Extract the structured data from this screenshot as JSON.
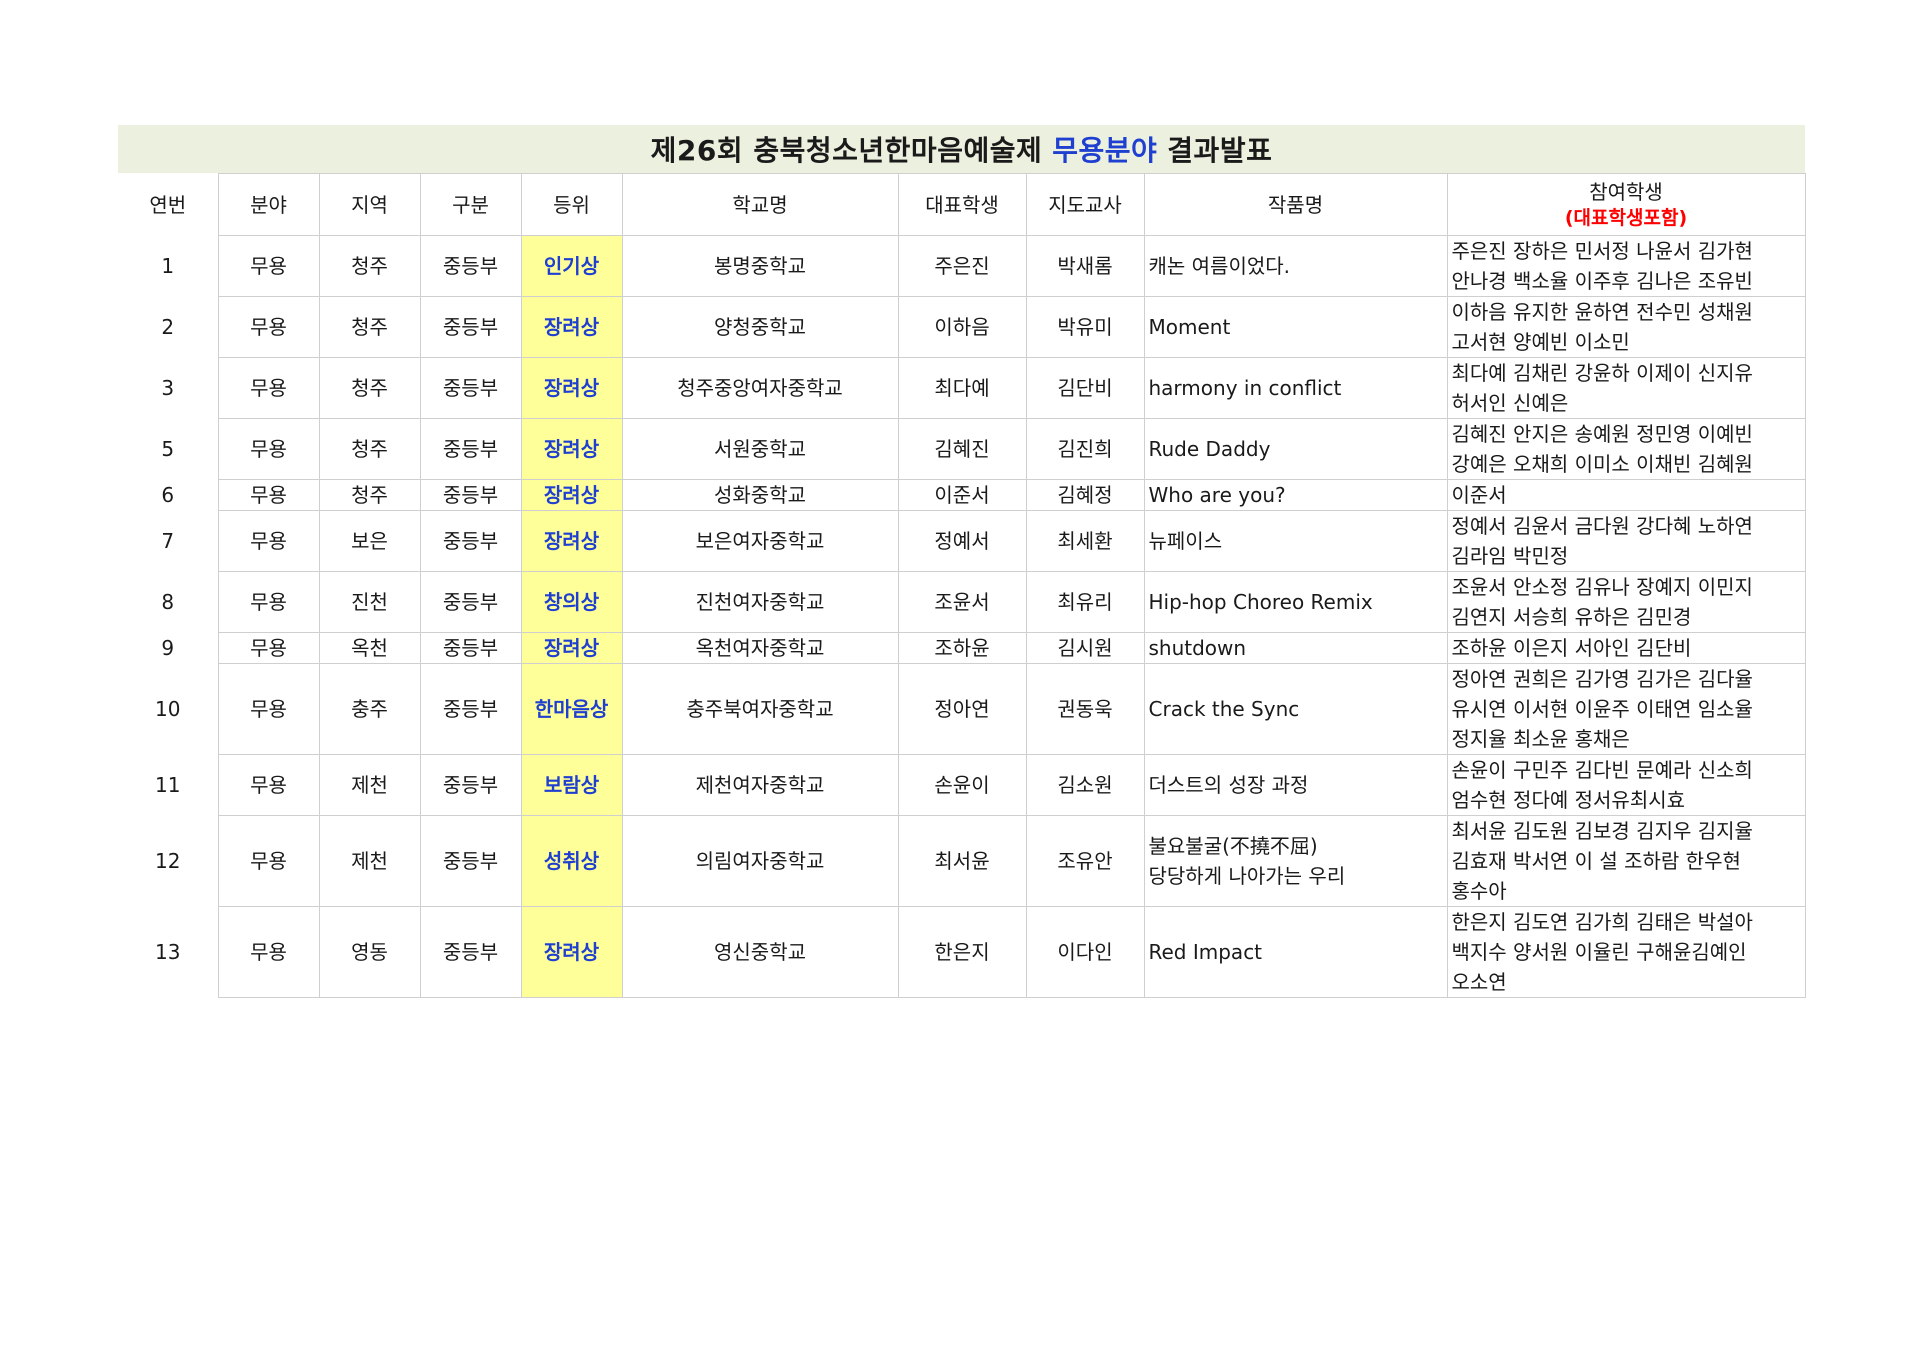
{
  "title": {
    "prefix": "제26회 충북청소년한마음예술제",
    "highlight": "무용분야",
    "suffix": "결과발표"
  },
  "headers": {
    "no": "연번",
    "field": "분야",
    "region": "지역",
    "division": "구분",
    "rank": "등위",
    "school": "학교명",
    "rep": "대표학생",
    "teacher": "지도교사",
    "work": "작품명",
    "students": "참여학생",
    "students_note": "(대표학생포함)"
  },
  "colors": {
    "title_bg": "#ebf1de",
    "award_bg": "#ffff99",
    "award_text": "#1f3fd1",
    "note_text": "#ff0000"
  },
  "rows": [
    {
      "no": "1",
      "field": "무용",
      "region": "청주",
      "division": "중등부",
      "rank": "인기상",
      "school": "봉명중학교",
      "rep": "주은진",
      "teacher": "박새롬",
      "work": [
        "캐논 여름이었다."
      ],
      "students": [
        "주은진 장하은 민서정 나윤서 김가현",
        "안나경 백소율 이주후 김나은 조유빈"
      ]
    },
    {
      "no": "2",
      "field": "무용",
      "region": "청주",
      "division": "중등부",
      "rank": "장려상",
      "school": "양청중학교",
      "rep": "이하음",
      "teacher": "박유미",
      "work": [
        "Moment"
      ],
      "students": [
        "이하음 유지한 윤하연 전수민 성채원",
        "고서현 양예빈 이소민"
      ]
    },
    {
      "no": "3",
      "field": "무용",
      "region": "청주",
      "division": "중등부",
      "rank": "장려상",
      "school": "청주중앙여자중학교",
      "rep": "최다예",
      "teacher": "김단비",
      "work": [
        "harmony in conflict"
      ],
      "students": [
        "최다예 김채린 강윤하 이제이 신지유",
        "허서인 신예은"
      ]
    },
    {
      "no": "5",
      "field": "무용",
      "region": "청주",
      "division": "중등부",
      "rank": "장려상",
      "school": "서원중학교",
      "rep": "김혜진",
      "teacher": "김진희",
      "work": [
        "Rude Daddy"
      ],
      "students": [
        "김혜진 안지은 송예원 정민영 이예빈",
        "강예은 오채희 이미소 이채빈 김혜원"
      ]
    },
    {
      "no": "6",
      "field": "무용",
      "region": "청주",
      "division": "중등부",
      "rank": "장려상",
      "school": "성화중학교",
      "rep": "이준서",
      "teacher": "김혜정",
      "work": [
        "Who are you?"
      ],
      "students": [
        "이준서"
      ]
    },
    {
      "no": "7",
      "field": "무용",
      "region": "보은",
      "division": "중등부",
      "rank": "장려상",
      "school": "보은여자중학교",
      "rep": "정예서",
      "teacher": "최세환",
      "work": [
        "뉴페이스"
      ],
      "students": [
        "정예서 김윤서 금다원 강다혜 노하연",
        "김라임 박민정"
      ]
    },
    {
      "no": "8",
      "field": "무용",
      "region": "진천",
      "division": "중등부",
      "rank": "창의상",
      "school": "진천여자중학교",
      "rep": "조윤서",
      "teacher": "최유리",
      "work": [
        "Hip-hop Choreo Remix"
      ],
      "students": [
        "조윤서 안소정 김유나 장예지 이민지",
        "김연지 서승희 유하은 김민경"
      ]
    },
    {
      "no": "9",
      "field": "무용",
      "region": "옥천",
      "division": "중등부",
      "rank": "장려상",
      "school": "옥천여자중학교",
      "rep": "조하윤",
      "teacher": "김시원",
      "work": [
        "shutdown"
      ],
      "students": [
        "조하윤 이은지 서아인 김단비"
      ]
    },
    {
      "no": "10",
      "field": "무용",
      "region": "충주",
      "division": "중등부",
      "rank": "한마음상",
      "school": "충주북여자중학교",
      "rep": "정아연",
      "teacher": "권동욱",
      "work": [
        "Crack the Sync"
      ],
      "students": [
        "정아연 권희은 김가영 김가은 김다율",
        "유시연 이서현 이윤주 이태연 임소율",
        "정지율 최소윤 홍채은"
      ]
    },
    {
      "no": "11",
      "field": "무용",
      "region": "제천",
      "division": "중등부",
      "rank": "보람상",
      "school": "제천여자중학교",
      "rep": "손윤이",
      "teacher": "김소원",
      "work": [
        "더스트의 성장 과정"
      ],
      "students": [
        "손윤이 구민주 김다빈 문예라 신소희",
        "엄수현 정다예 정서유최시효"
      ]
    },
    {
      "no": "12",
      "field": "무용",
      "region": "제천",
      "division": "중등부",
      "rank": "성취상",
      "school": "의림여자중학교",
      "rep": "최서윤",
      "teacher": "조유안",
      "work": [
        "불요불굴(不撓不屈)",
        "당당하게 나아가는 우리"
      ],
      "students": [
        "최서윤 김도원 김보경 김지우 김지율",
        "김효재 박서연 이 설 조하람 한우현",
        "홍수아"
      ]
    },
    {
      "no": "13",
      "field": "무용",
      "region": "영동",
      "division": "중등부",
      "rank": "장려상",
      "school": "영신중학교",
      "rep": "한은지",
      "teacher": "이다인",
      "work": [
        "Red Impact"
      ],
      "students": [
        "한은지 김도연 김가희 김태은 박설아",
        "백지수 양서원 이율린 구해윤김예인",
        "오소연"
      ]
    }
  ]
}
